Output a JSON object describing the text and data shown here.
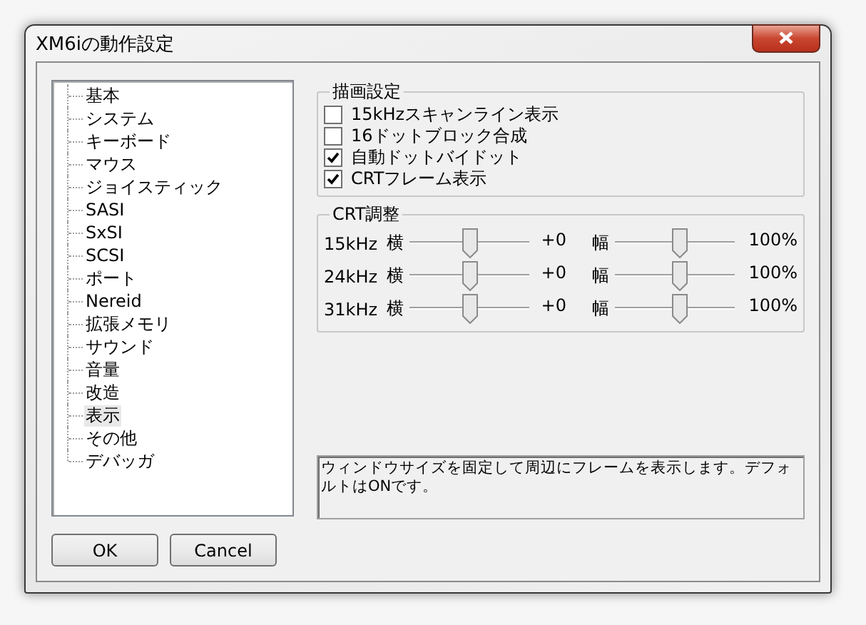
{
  "window": {
    "title": "XM6iの動作設定"
  },
  "tree": {
    "items": [
      {
        "label": "基本",
        "selected": false
      },
      {
        "label": "システム",
        "selected": false
      },
      {
        "label": "キーボード",
        "selected": false
      },
      {
        "label": "マウス",
        "selected": false
      },
      {
        "label": "ジョイスティック",
        "selected": false
      },
      {
        "label": "SASI",
        "selected": false
      },
      {
        "label": "SxSI",
        "selected": false
      },
      {
        "label": "SCSI",
        "selected": false
      },
      {
        "label": "ポート",
        "selected": false
      },
      {
        "label": "Nereid",
        "selected": false
      },
      {
        "label": "拡張メモリ",
        "selected": false
      },
      {
        "label": "サウンド",
        "selected": false
      },
      {
        "label": "音量",
        "selected": false
      },
      {
        "label": "改造",
        "selected": false
      },
      {
        "label": "表示",
        "selected": true
      },
      {
        "label": "その他",
        "selected": false
      },
      {
        "label": "デバッガ",
        "selected": false
      }
    ]
  },
  "render_group": {
    "title": "描画設定",
    "options": [
      {
        "label": "15kHzスキャンライン表示",
        "checked": false
      },
      {
        "label": "16ドットブロック合成",
        "checked": false
      },
      {
        "label": "自動ドットバイドット",
        "checked": true
      },
      {
        "label": "CRTフレーム表示",
        "checked": true
      }
    ]
  },
  "crt_group": {
    "title": "CRT調整",
    "rows": [
      {
        "freq": "15kHz",
        "sliders": [
          {
            "label": "横",
            "level": 0.5,
            "reading": "+0"
          },
          {
            "label": "幅",
            "level": 0.55,
            "reading": "100%"
          }
        ]
      },
      {
        "freq": "24kHz",
        "sliders": [
          {
            "label": "横",
            "level": 0.5,
            "reading": "+0"
          },
          {
            "label": "幅",
            "level": 0.55,
            "reading": "100%"
          }
        ]
      },
      {
        "freq": "31kHz",
        "sliders": [
          {
            "label": "横",
            "level": 0.5,
            "reading": "+0"
          },
          {
            "label": "幅",
            "level": 0.55,
            "reading": "100%"
          }
        ]
      }
    ]
  },
  "description": "ウィンドウサイズを固定して周辺にフレームを表示します。デフォルトはONです。",
  "buttons": [
    "OK",
    "Cancel"
  ]
}
